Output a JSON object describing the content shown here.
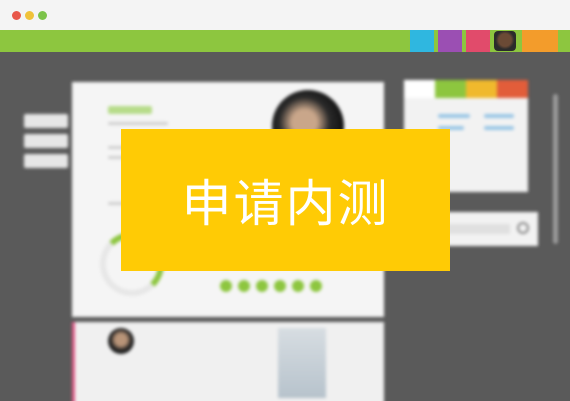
{
  "window": {
    "controls": [
      "close",
      "minimize",
      "maximize"
    ],
    "colors": {
      "close": "#e8574a",
      "minimize": "#f0c23a",
      "maximize": "#7cc34a"
    }
  },
  "header": {
    "bar_color": "#8dc63f",
    "swatches": [
      "#2fb7e0",
      "#9b4fb3",
      "#e14b6b",
      "#f39c2b"
    ]
  },
  "left_nav": {
    "items": [
      "",
      "",
      ""
    ]
  },
  "card": {
    "accent": "#8dc63f"
  },
  "side_panel": {
    "tab_colors": [
      "#ffffff",
      "#8dc63f",
      "#f0b92d",
      "#e25d3a"
    ]
  },
  "overlay": {
    "label": "申请内测",
    "background": "#ffcb05",
    "text_color": "#ffffff"
  }
}
